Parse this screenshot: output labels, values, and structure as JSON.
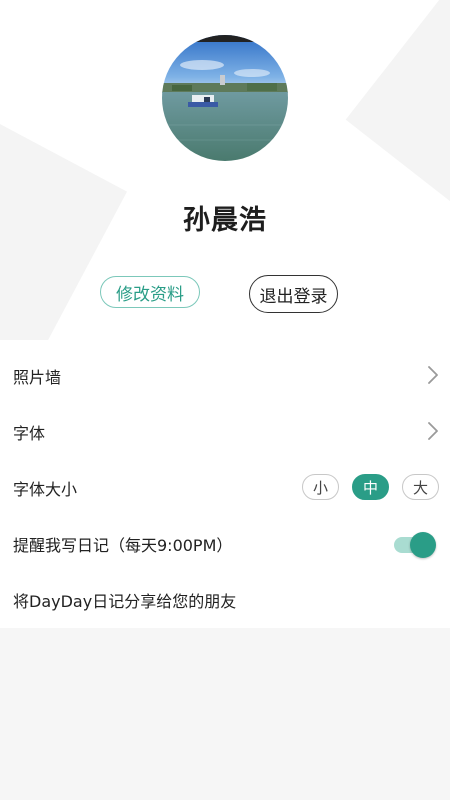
{
  "profile": {
    "username": "孙晨浩",
    "edit_label": "修改资料",
    "logout_label": "退出登录"
  },
  "menu": {
    "photo_wall": "照片墙",
    "font": "字体",
    "font_size": {
      "label": "字体大小",
      "options": [
        "小",
        "中",
        "大"
      ],
      "selected": "中"
    },
    "reminder": {
      "label": "提醒我写日记（每天9:00PM）",
      "enabled": true
    },
    "share": "将DayDay日记分享给您的朋友"
  },
  "colors": {
    "accent": "#2a9d87",
    "accent_light": "#a9dcd1",
    "background": "#f6f6f6"
  },
  "icons": {
    "chevron": "chevron-right-icon",
    "avatar": "lake-photo-avatar"
  }
}
